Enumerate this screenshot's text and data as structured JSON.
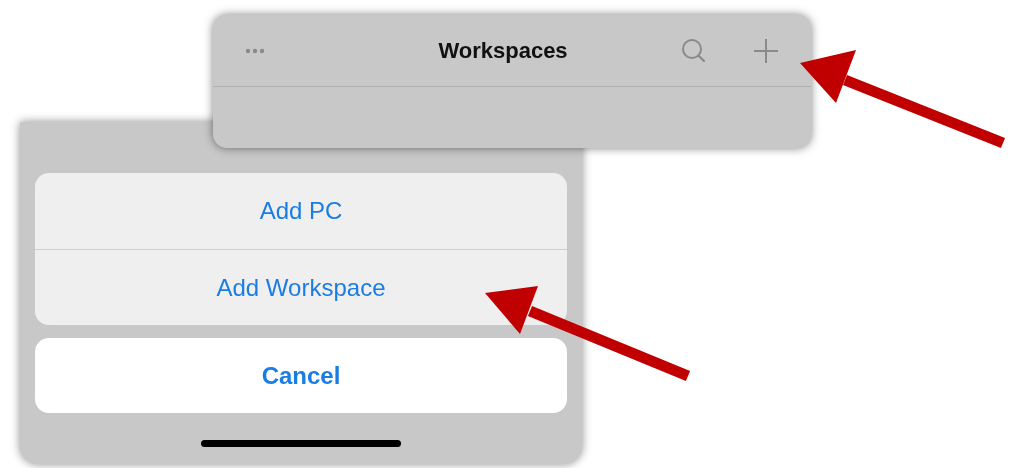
{
  "nav_bar": {
    "title": "Workspaces"
  },
  "action_sheet": {
    "actions": [
      {
        "label": "Add PC"
      },
      {
        "label": "Add Workspace"
      }
    ],
    "cancel": {
      "label": "Cancel"
    }
  }
}
